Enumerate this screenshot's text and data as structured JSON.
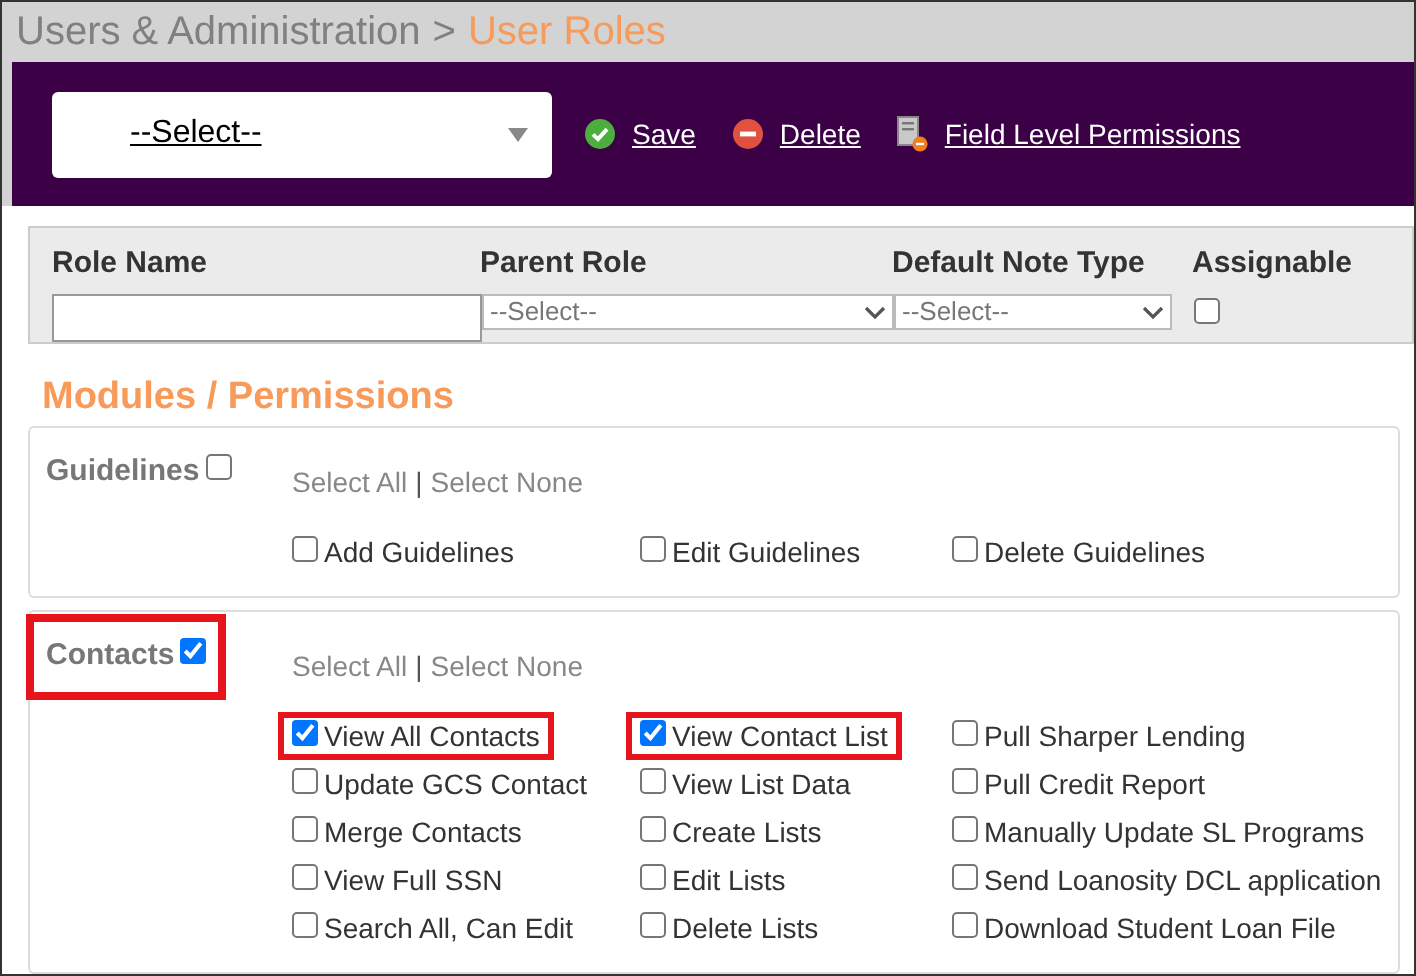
{
  "breadcrumb": {
    "parent": "Users & Administration",
    "separator": ">",
    "current": "User Roles"
  },
  "toolbar": {
    "role_select": "--Select--",
    "actions": [
      {
        "kind": "save",
        "label": "Save"
      },
      {
        "kind": "delete",
        "label": "Delete"
      },
      {
        "kind": "fields",
        "label": "Field Level Permissions"
      }
    ]
  },
  "role_form": {
    "columns": [
      "Role Name",
      "Parent Role",
      "Default Note Type",
      "Assignable"
    ],
    "parent_role": "--Select--",
    "default_note_type": "--Select--",
    "assignable": false
  },
  "section_title": "Modules / Permissions",
  "modules": [
    {
      "name": "Guidelines",
      "checked": false,
      "highlighted": false,
      "select_all": "Select All",
      "separator": "|",
      "select_none": "Select None",
      "columns": [
        [
          {
            "label": "Add Guidelines",
            "checked": false,
            "highlighted": false
          }
        ],
        [
          {
            "label": "Edit Guidelines",
            "checked": false,
            "highlighted": false
          }
        ],
        [
          {
            "label": "Delete Guidelines",
            "checked": false,
            "highlighted": false
          }
        ]
      ]
    },
    {
      "name": "Contacts",
      "checked": true,
      "highlighted": true,
      "select_all": "Select All",
      "separator": "|",
      "select_none": "Select None",
      "columns": [
        [
          {
            "label": "View All Contacts",
            "checked": true,
            "highlighted": true
          },
          {
            "label": "Update GCS Contact",
            "checked": false,
            "highlighted": false
          },
          {
            "label": "Merge Contacts",
            "checked": false,
            "highlighted": false
          },
          {
            "label": "View Full SSN",
            "checked": false,
            "highlighted": false
          },
          {
            "label": "Search All, Can Edit",
            "checked": false,
            "highlighted": false
          }
        ],
        [
          {
            "label": "View Contact List",
            "checked": true,
            "highlighted": true
          },
          {
            "label": "View List Data",
            "checked": false,
            "highlighted": false
          },
          {
            "label": "Create Lists",
            "checked": false,
            "highlighted": false
          },
          {
            "label": "Edit Lists",
            "checked": false,
            "highlighted": false
          },
          {
            "label": "Delete Lists",
            "checked": false,
            "highlighted": false
          }
        ],
        [
          {
            "label": "Pull Sharper Lending",
            "checked": false,
            "highlighted": false
          },
          {
            "label": "Pull Credit Report",
            "checked": false,
            "highlighted": false
          },
          {
            "label": "Manually Update SL Programs",
            "checked": false,
            "highlighted": false
          },
          {
            "label": "Send Loanosity DCL application",
            "checked": false,
            "highlighted": false
          },
          {
            "label": "Download Student Loan File",
            "checked": false,
            "highlighted": false
          }
        ]
      ]
    }
  ]
}
